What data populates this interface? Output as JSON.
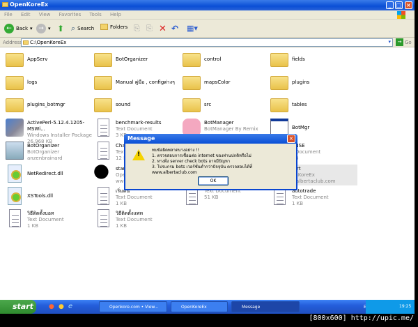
{
  "window": {
    "title": "OpenKoreEx"
  },
  "menu": [
    "File",
    "Edit",
    "View",
    "Favorites",
    "Tools",
    "Help"
  ],
  "toolbar": {
    "back": "Back",
    "search": "Search",
    "folders": "Folders"
  },
  "address": {
    "label": "Address",
    "value": "C:\\OpenKoreEx",
    "go": "Go"
  },
  "items": [
    {
      "name": "AppServ",
      "type": "folder"
    },
    {
      "name": "BotOrganizer",
      "type": "folder"
    },
    {
      "name": "control",
      "type": "folder"
    },
    {
      "name": "fields",
      "type": "folder"
    },
    {
      "name": "logs",
      "type": "folder"
    },
    {
      "name": "Manual คู่มือ , configต่างๆ",
      "type": "folder"
    },
    {
      "name": "mapsColor",
      "type": "folder"
    },
    {
      "name": "plugins",
      "type": "folder"
    },
    {
      "name": "plugins_botmgr",
      "type": "folder"
    },
    {
      "name": "sound",
      "type": "folder"
    },
    {
      "name": "src",
      "type": "folder"
    },
    {
      "name": "tables",
      "type": "folder"
    },
    {
      "name": "ActivePerl-5.12.4.1205-MSWi...",
      "l2": "Windows Installer Package",
      "l3": "26,968 KB",
      "type": "msi"
    },
    {
      "name": "benchmark-results",
      "l2": "Text Document",
      "l3": "3 KB",
      "type": "doc"
    },
    {
      "name": "BotManager",
      "l2": "BotManager By Remix",
      "type": "app"
    },
    {
      "name": "BotMgr",
      "type": "win"
    },
    {
      "name": "BotOrganizer",
      "l2": "BotOrganizer",
      "l3": "anzenbrainard",
      "type": "app2"
    },
    {
      "name": "Char",
      "l2": "Text",
      "l3": "12 K",
      "type": "doc"
    },
    {
      "name": "",
      "type": "none"
    },
    {
      "name": "ENSE",
      "l2": "t Document",
      "l3": "KB",
      "type": "none"
    },
    {
      "name": "NetRedirect.dll",
      "type": "dll"
    },
    {
      "name": "start",
      "l2": "Open",
      "l3": "www",
      "type": "kore"
    },
    {
      "name": "",
      "type": "none"
    },
    {
      "name": "tart",
      "l2": "enKoreEx",
      "l3": "v.albertaclub.com",
      "type": "none",
      "selected": true
    },
    {
      "name": "XSTools.dll",
      "type": "dll"
    },
    {
      "name": "เริ่มต้น",
      "l2": "Text Document",
      "l3": "1 KB",
      "type": "doc"
    },
    {
      "name": "",
      "l2": "Text Document",
      "l3": "51 KB",
      "type": "doc"
    },
    {
      "name": "autotrade",
      "l2": "Text Document",
      "l3": "1 KB",
      "type": "doc"
    },
    {
      "name": "วิธีติดตั้งบอท",
      "l2": "Text Document",
      "l3": "1 KB",
      "type": "doc"
    },
    {
      "name": "วิธีติดตั้งแพท",
      "l2": "Text Document",
      "l3": "1 KB",
      "type": "doc"
    }
  ],
  "dialog": {
    "title": "Message",
    "lines": [
      "พบข้อผิดพลาดบางอย่าง !!",
      "1. ตรวจสอบการเชื่อมต่อ internet ของท่านปกติหรือไม่",
      "2. ทางฝั่ง server check bots อาจมีปัญหา",
      "3. โปรแกรม bots เวอร์ชั่นต่ำกว่าปัจจุบัน ตรวจสอบได้ที่ www.albertaclub.com"
    ],
    "ok": "OK"
  },
  "taskbar": {
    "start": "start",
    "tasks": [
      "Openkore.com • View...",
      "OpenKoreEx",
      "Message"
    ],
    "lang": "EN",
    "clock": "19:25"
  },
  "watermark": "[800x600] http://upic.me/"
}
